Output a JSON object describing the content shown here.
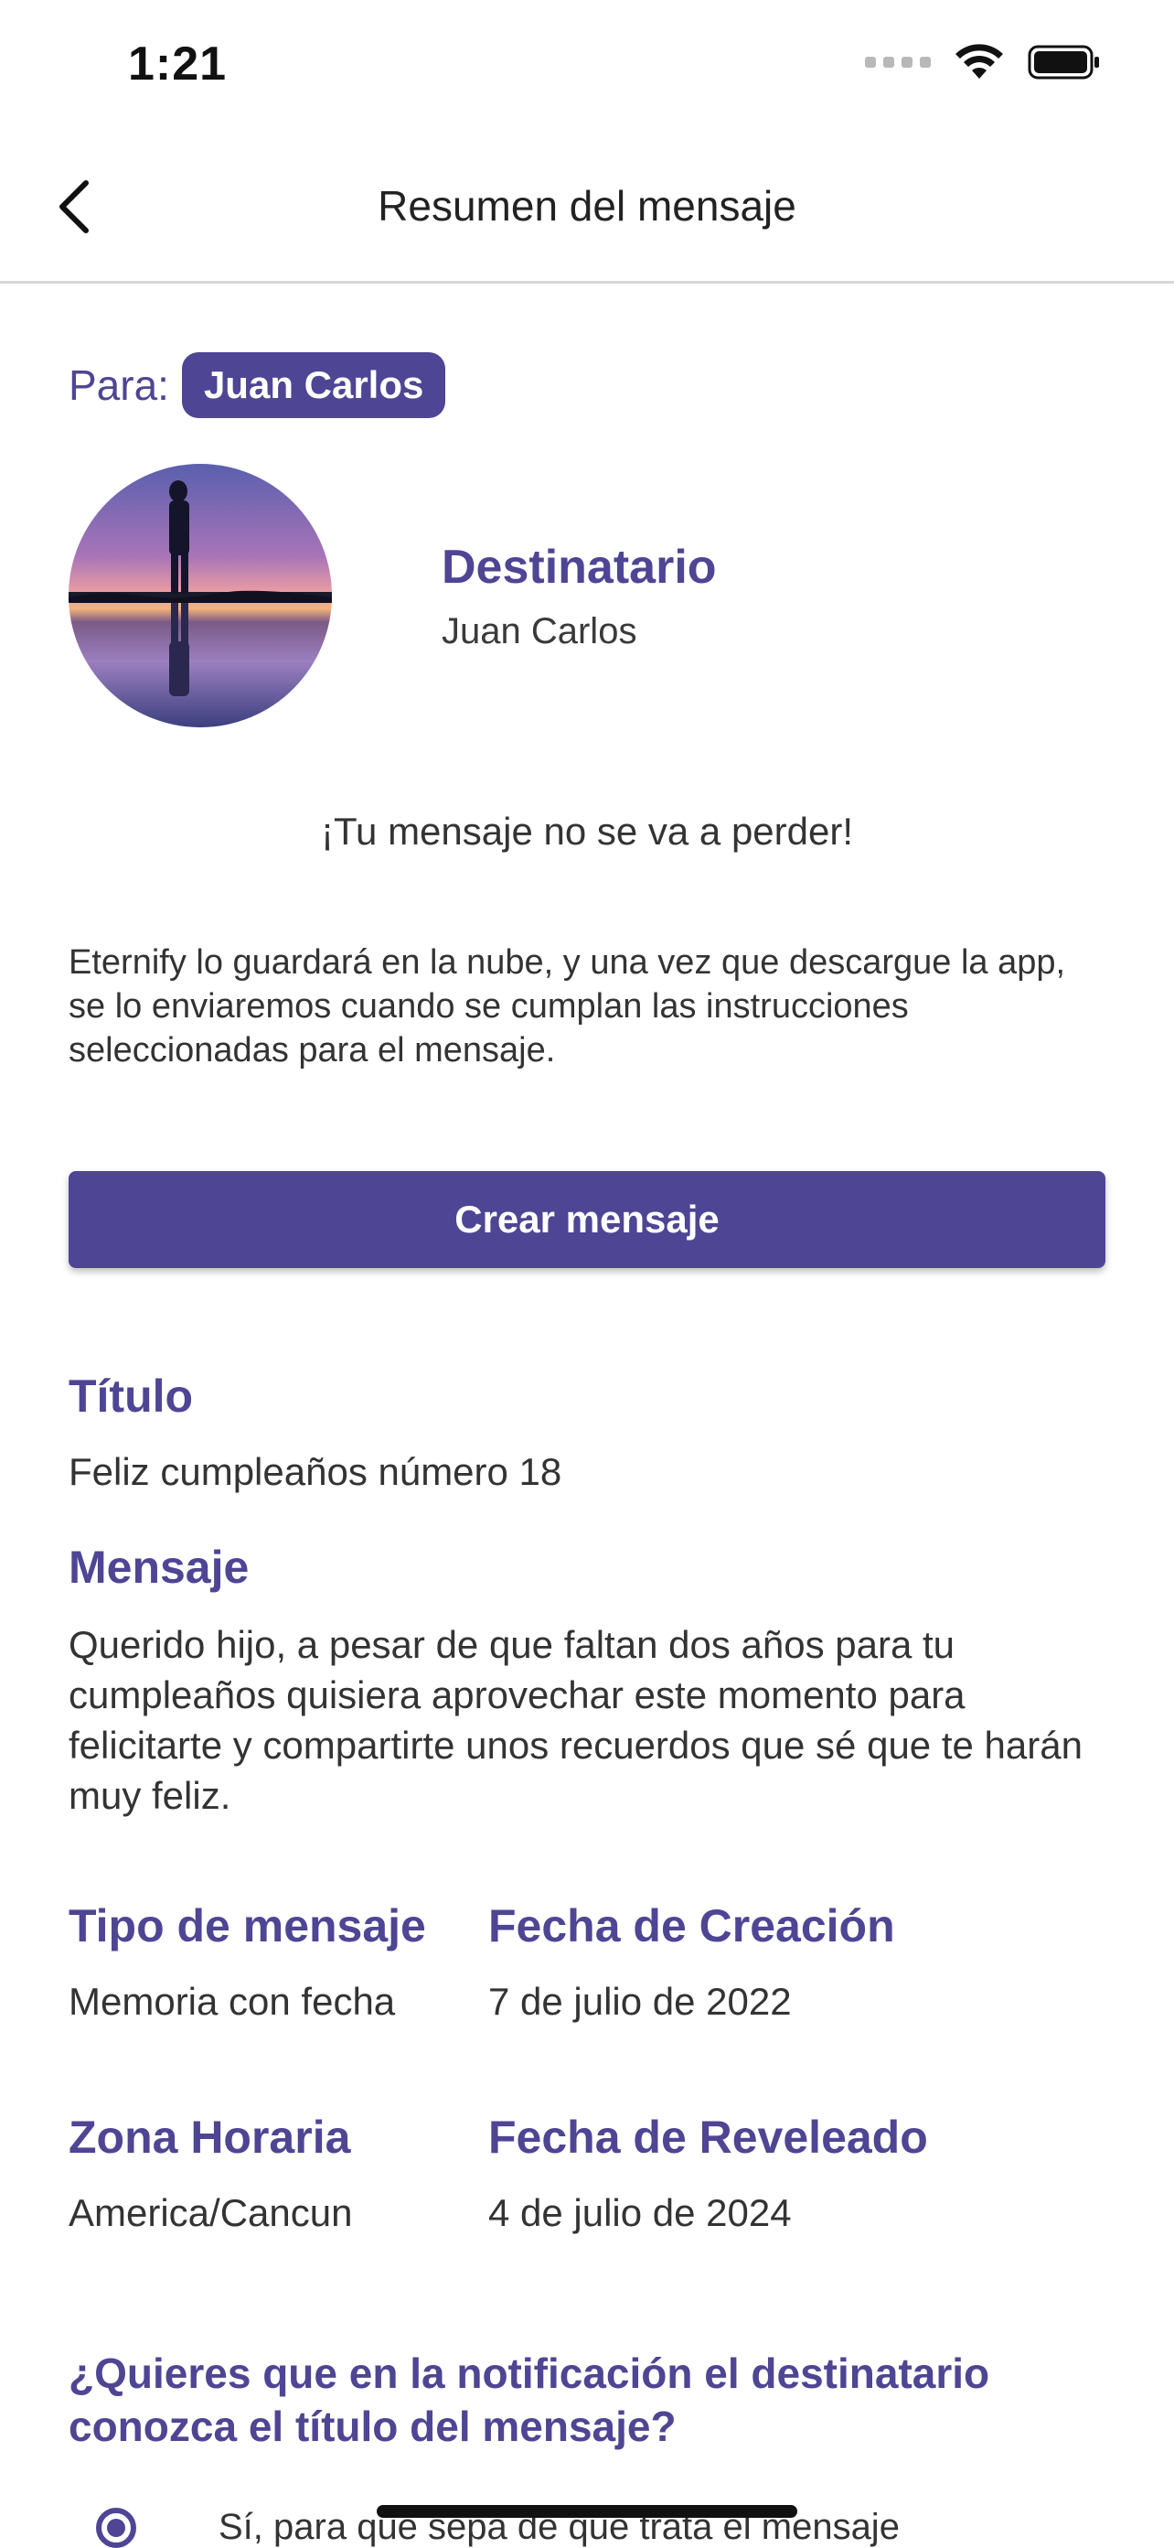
{
  "status_bar": {
    "time": "1:21",
    "icons": [
      "signal-dots-icon",
      "wifi-icon",
      "battery-icon"
    ]
  },
  "nav": {
    "title": "Resumen del mensaje",
    "back_icon": "chevron-left-icon"
  },
  "recipient": {
    "para_label": "Para:",
    "chip_name": "Juan Carlos",
    "heading": "Destinatario",
    "name": "Juan Carlos"
  },
  "notice": {
    "heading": "¡Tu mensaje no se va a perder!",
    "body": "Eternify lo guardará en la nube, y una vez que descargue la app, se lo enviaremos cuando se cumplan las instrucciones seleccionadas para el mensaje."
  },
  "create_button_label": "Crear mensaje",
  "details": {
    "title_label": "Título",
    "title_value": "Feliz cumpleaños número 18",
    "message_label": "Mensaje",
    "message_value": "Querido hijo, a pesar de que faltan dos años para tu cumpleaños quisiera aprovechar este momento para felicitarte y compartirte unos recuerdos que sé que te harán muy feliz.",
    "type_label": "Tipo de mensaje",
    "type_value": "Memoria con fecha",
    "created_label": "Fecha de Creación",
    "created_value": "7 de julio de 2022",
    "timezone_label": "Zona Horaria",
    "timezone_value": "America/Cancun",
    "reveal_label": "Fecha de Reveleado",
    "reveal_value": "4 de julio de 2024"
  },
  "notification_question": "¿Quieres que en la notificación el destinatario conozca el título del mensaje?",
  "radio_option_label": "Sí, para que sepa de que trata el mensaje",
  "colors": {
    "accent": "#4e4594",
    "text": "#333333",
    "divider": "#d6d6d6"
  }
}
